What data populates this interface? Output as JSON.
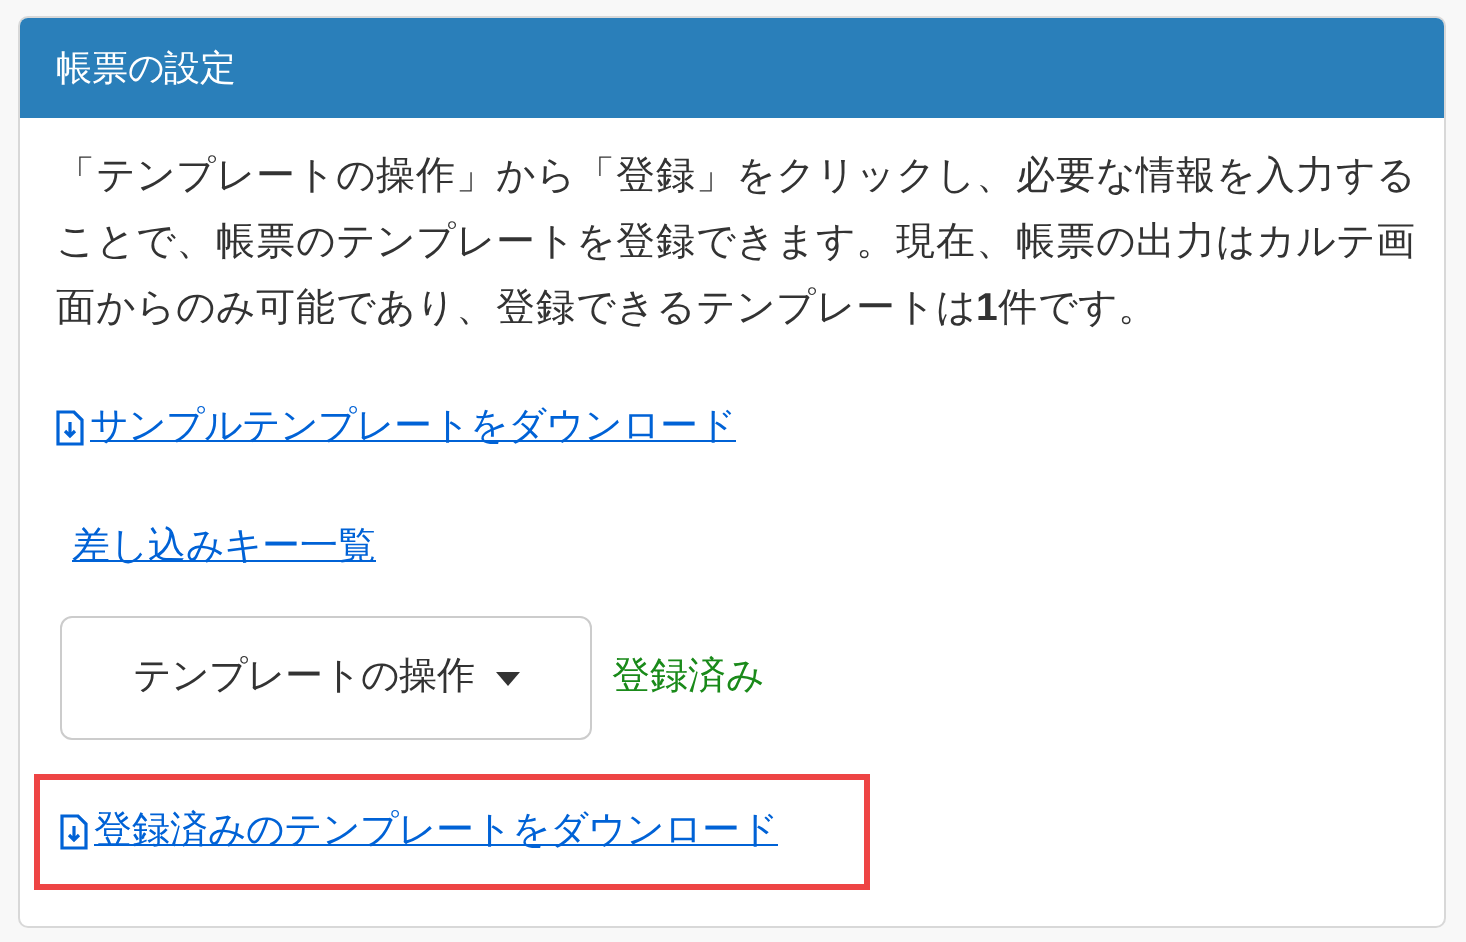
{
  "panel": {
    "title": "帳票の設定",
    "description": "「テンプレートの操作」から「登録」をクリックし、必要な情報を入力することで、帳票のテンプレートを登録できます。現在、帳票の出力はカルテ画面からのみ可能であり、登録できるテンプレートは**1**件です。",
    "sample_link": {
      "label": "サンプルテンプレートをダウンロード"
    },
    "keys_link": {
      "label": "差し込みキー一覧"
    },
    "template_menu": {
      "label": "テンプレートの操作"
    },
    "status": "登録済み",
    "registered_link": {
      "label": "登録済みのテンプレートをダウンロード",
      "highlighted": true
    }
  }
}
